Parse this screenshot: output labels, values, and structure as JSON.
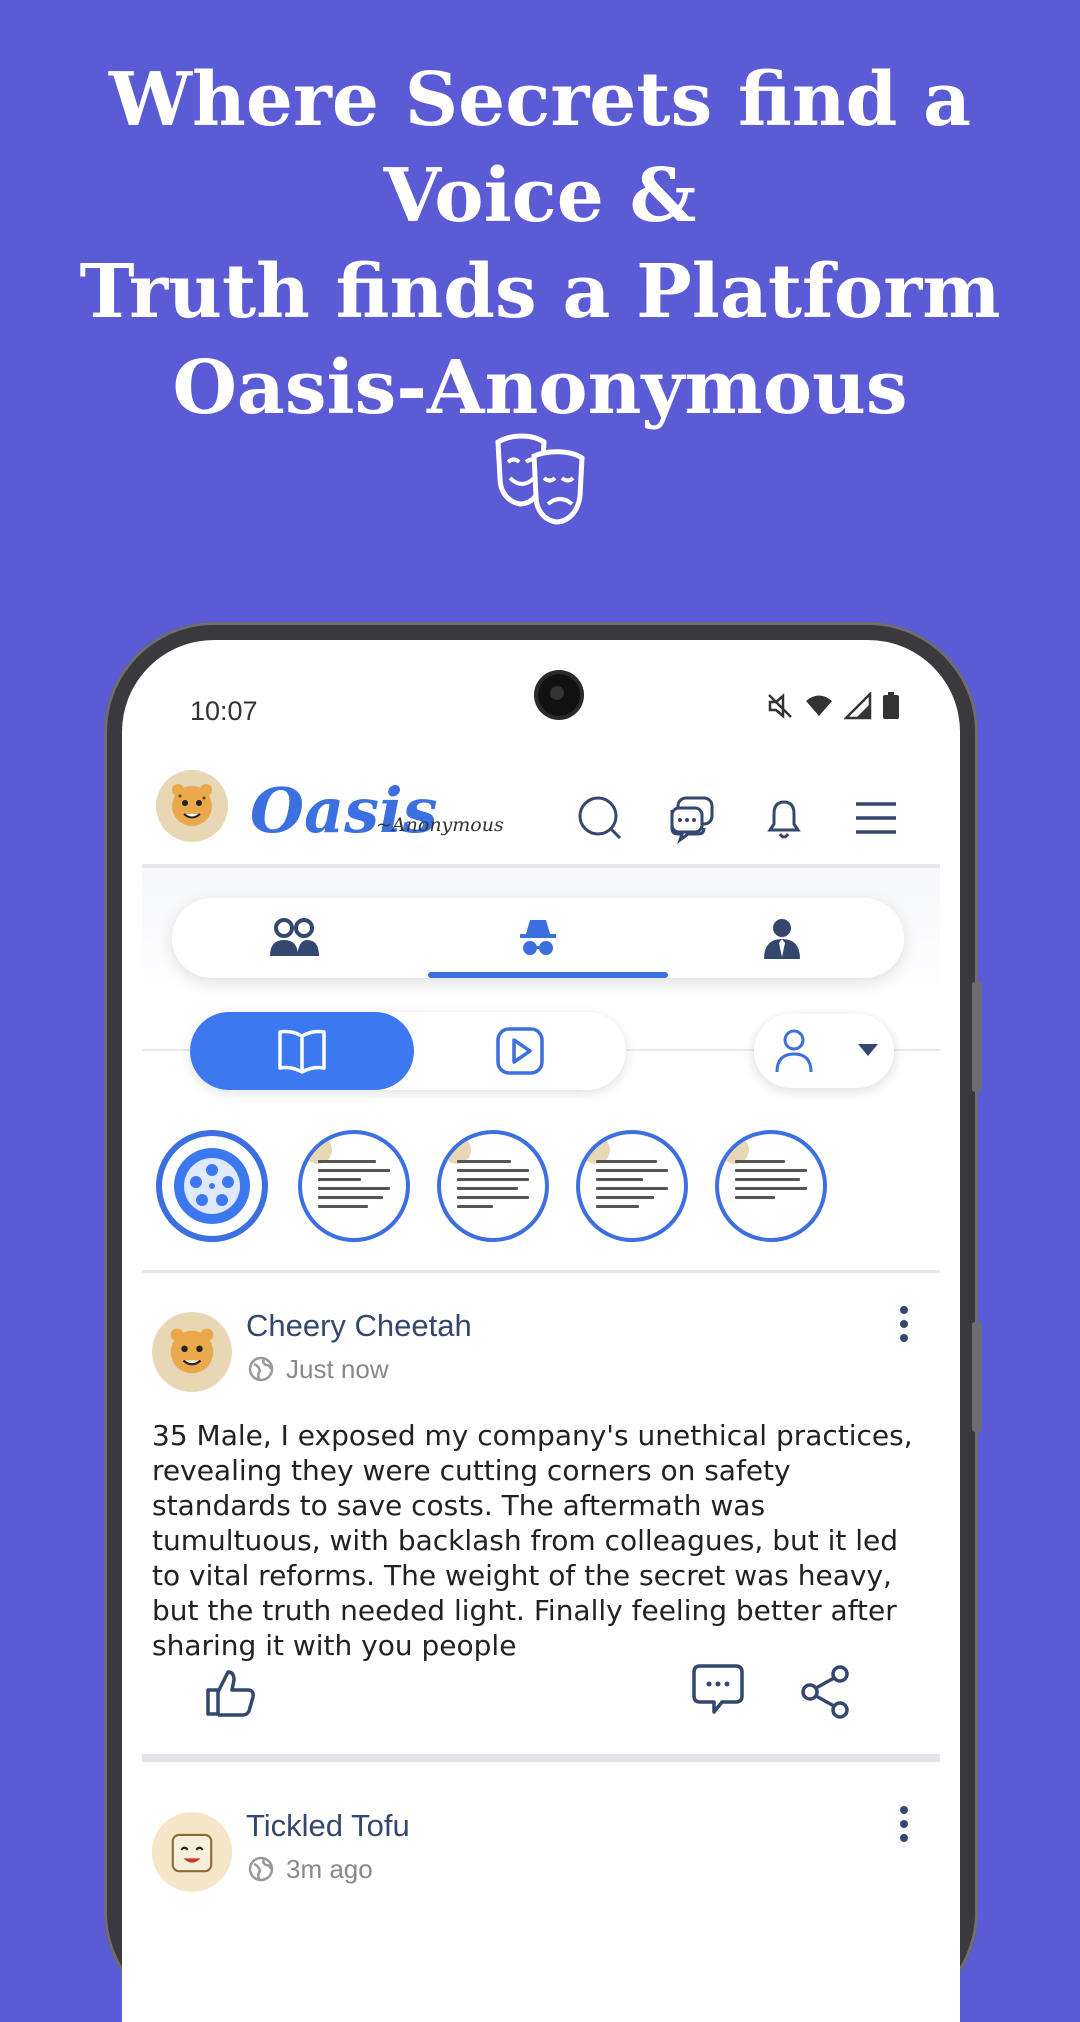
{
  "promo": {
    "headline_lines": [
      "Where Secrets find a",
      "Voice &",
      "Truth finds a Platform",
      "Oasis-Anonymous"
    ]
  },
  "status_bar": {
    "time": "10:07",
    "icons": [
      "mute-icon",
      "wifi-icon",
      "signal-icon",
      "battery-icon"
    ]
  },
  "app": {
    "brand": "Oasis",
    "brand_sub": "~Anonymous",
    "header_icons": [
      "search-icon",
      "chat-icon",
      "bell-icon",
      "menu-icon"
    ],
    "tabs": [
      {
        "name": "friends",
        "icon": "people-icon"
      },
      {
        "name": "anonymous",
        "icon": "spy-icon",
        "active": true
      },
      {
        "name": "personal",
        "icon": "person-tie-icon"
      }
    ],
    "segments": [
      {
        "name": "stories",
        "icon": "book-icon",
        "active": true
      },
      {
        "name": "videos",
        "icon": "play-icon"
      }
    ],
    "profile_filter_icon": "user-icon",
    "stories_count": 5
  },
  "posts": [
    {
      "author": "Cheery Cheetah",
      "time": "Just now",
      "body": "35 Male, I exposed my company's unethical practices, revealing they were cutting corners on safety standards to save costs. The aftermath was tumultuous, with backlash from colleagues, but it led to vital reforms. The weight of the secret was heavy, but the truth needed light. Finally feeling better after sharing it with you people"
    },
    {
      "author": "Tickled Tofu",
      "time": "3m ago"
    }
  ],
  "colors": {
    "background": "#5b5bd6",
    "accent": "#3c6fe0",
    "text_dark": "#34476e"
  }
}
